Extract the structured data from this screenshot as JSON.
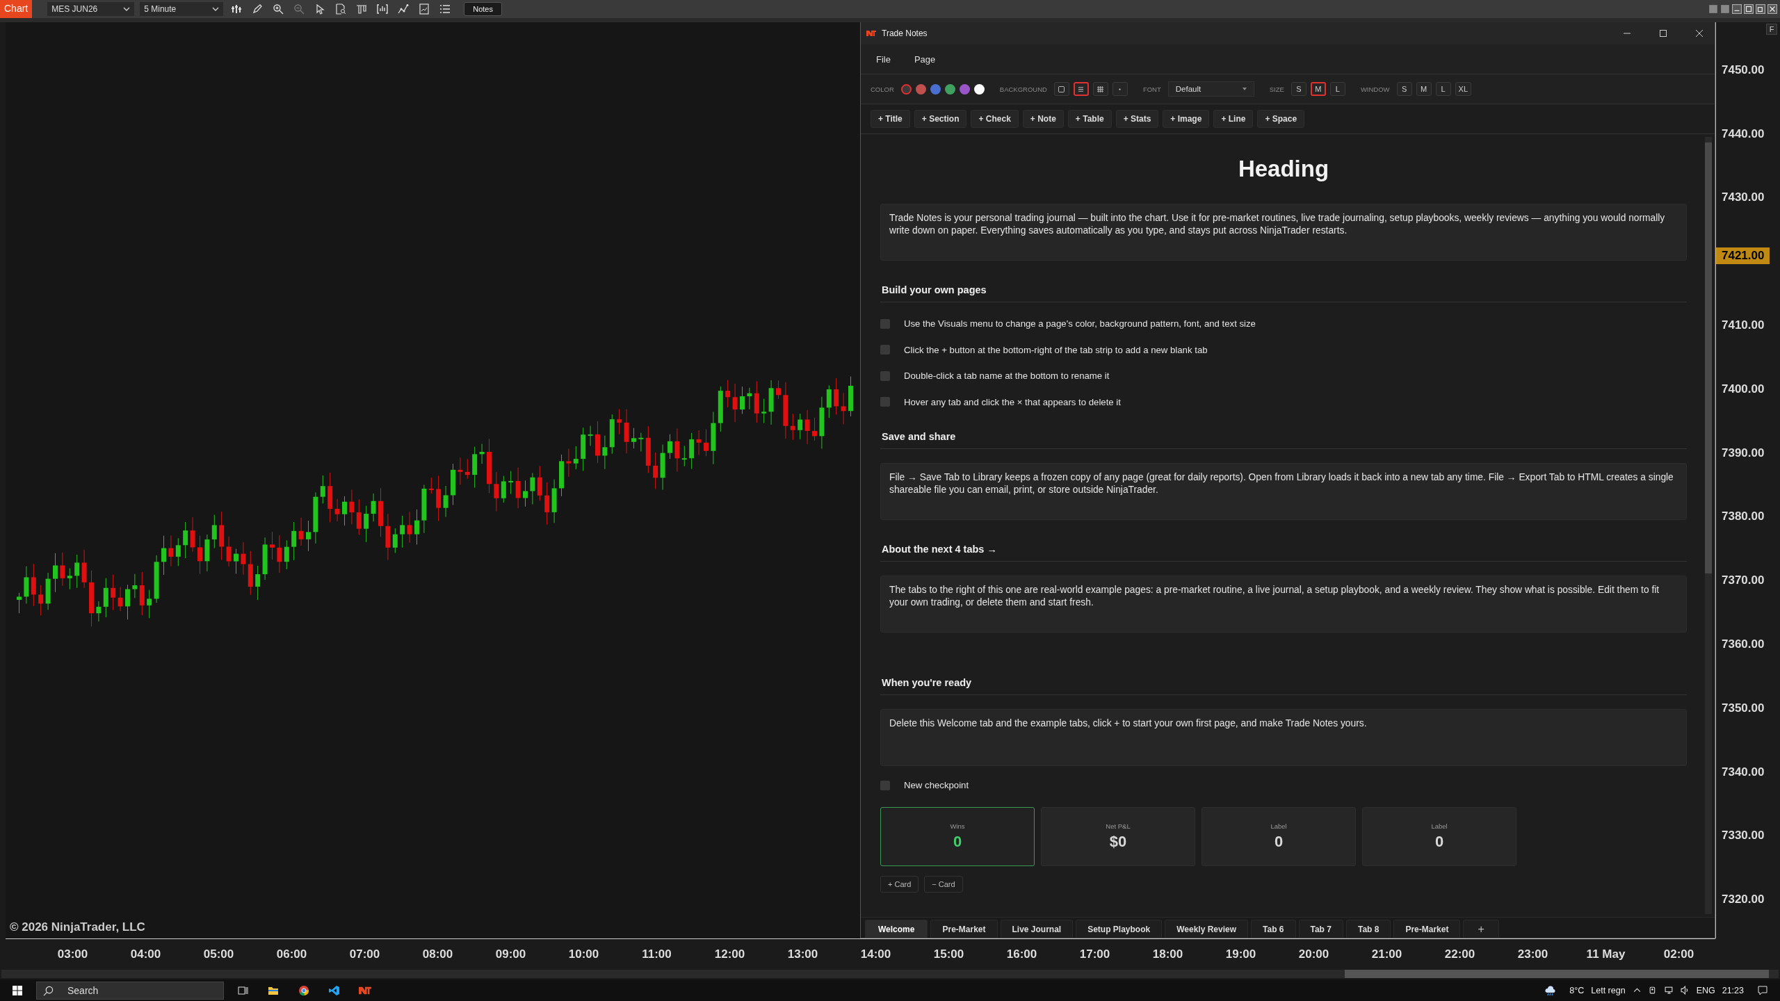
{
  "top_bar": {
    "app_label": "Chart",
    "instrument": "MES JUN26",
    "interval": "5 Minute",
    "notes_button": "Notes"
  },
  "chart": {
    "copyright": "© 2026 NinjaTrader, LLC",
    "price_labels": [
      {
        "kind": "tick",
        "text": "7450.00"
      },
      {
        "kind": "tick",
        "text": "7440.00"
      },
      {
        "kind": "tick",
        "text": "7430.00"
      },
      {
        "kind": "current",
        "text": "7421.00"
      },
      {
        "kind": "tick",
        "text": "7410.00"
      },
      {
        "kind": "tick",
        "text": "7400.00"
      },
      {
        "kind": "tick",
        "text": "7390.00"
      },
      {
        "kind": "tick",
        "text": "7380.00"
      },
      {
        "kind": "tick",
        "text": "7370.00"
      },
      {
        "kind": "tick",
        "text": "7360.00"
      },
      {
        "kind": "tick",
        "text": "7350.00"
      },
      {
        "kind": "tick",
        "text": "7340.00"
      },
      {
        "kind": "tick",
        "text": "7330.00"
      },
      {
        "kind": "tick",
        "text": "7320.00"
      }
    ],
    "axis_button": "F",
    "time_labels": [
      "03:00",
      "04:00",
      "05:00",
      "06:00",
      "07:00",
      "08:00",
      "09:00",
      "10:00",
      "11:00",
      "12:00",
      "13:00",
      "14:00",
      "15:00",
      "16:00",
      "17:00",
      "18:00",
      "19:00",
      "20:00",
      "21:00",
      "22:00",
      "23:00",
      "11 May",
      "02:00"
    ]
  },
  "notes_window": {
    "title": "Trade Notes",
    "menu": [
      "File",
      "Page"
    ],
    "toolbar": {
      "color_label": "COLOR",
      "colors": [
        {
          "color": "#3a3a3a",
          "selected": true
        },
        {
          "color": "#c0504d",
          "selected": false
        },
        {
          "color": "#4a6fd0",
          "selected": false
        },
        {
          "color": "#3fa060",
          "selected": false
        },
        {
          "color": "#9a55c8",
          "selected": false
        },
        {
          "color": "#ffffff",
          "selected": false
        }
      ],
      "background_label": "BACKGROUND",
      "backgrounds": [
        {
          "kind": "plain",
          "selected": false
        },
        {
          "kind": "lines",
          "selected": true
        },
        {
          "kind": "grid",
          "selected": false
        },
        {
          "kind": "dots",
          "selected": false
        }
      ],
      "font_label": "FONT",
      "font": "Default",
      "size_label": "SIZE",
      "sizes": [
        {
          "label": "S",
          "selected": false
        },
        {
          "label": "M",
          "selected": true
        },
        {
          "label": "L",
          "selected": false
        }
      ],
      "window_label": "WINDOW",
      "windows": [
        {
          "label": "S",
          "selected": false
        },
        {
          "label": "M",
          "selected": false
        },
        {
          "label": "L",
          "selected": false
        },
        {
          "label": "XL",
          "selected": false
        }
      ]
    },
    "insert_buttons": [
      "+ Title",
      "+ Section",
      "+ Check",
      "+ Note",
      "+ Table",
      "+ Stats",
      "+ Image",
      "+ Line",
      "+ Space"
    ],
    "blocks": [
      {
        "kind": "title",
        "text": "Heading"
      },
      {
        "kind": "note",
        "text": "Trade Notes is your personal trading journal — built into the chart. Use it for pre-market routines, live trade journaling, setup playbooks, weekly reviews — anything you would normally write down on paper. Everything saves automatically as you type, and stays put across NinjaTrader restarts."
      },
      {
        "kind": "section",
        "text": "Build your own pages"
      },
      {
        "kind": "check",
        "text": "Use the Visuals menu to change a page's color, background pattern, font, and text size",
        "checked": false
      },
      {
        "kind": "check",
        "text": "Click the + button at the bottom-right of the tab strip to add a new blank tab",
        "checked": false
      },
      {
        "kind": "check",
        "text": "Double-click a tab name at the bottom to rename it",
        "checked": false
      },
      {
        "kind": "check",
        "text": "Hover any tab and click the × that appears to delete it",
        "checked": false
      },
      {
        "kind": "section",
        "text": "Save and share"
      },
      {
        "kind": "note",
        "text": "File → Save Tab to Library keeps a frozen copy of any page (great for daily reports). Open from Library loads it back into a new tab any time. File → Export Tab to HTML creates a single shareable file you can email, print, or store outside NinjaTrader."
      },
      {
        "kind": "section",
        "text": "About the next 4 tabs →"
      },
      {
        "kind": "note",
        "text": "The tabs to the right of this one are real-world example pages: a pre-market routine, a live journal, a setup playbook, and a weekly review. They show what is possible. Edit them to fit your own trading, or delete them and start fresh."
      },
      {
        "kind": "space"
      },
      {
        "kind": "section",
        "text": "When you're ready"
      },
      {
        "kind": "note",
        "text": "Delete this Welcome tab and the example tabs, click + to start your own first page, and make Trade Notes yours."
      },
      {
        "kind": "check",
        "text": "New checkpoint",
        "checked": false
      },
      {
        "kind": "stats",
        "cards": [
          {
            "label": "Wins",
            "value": "0",
            "highlighted": true
          },
          {
            "label": "Net P&L",
            "value": "$0",
            "highlighted": false
          },
          {
            "label": "Label",
            "value": "0",
            "highlighted": false
          },
          {
            "label": "Label",
            "value": "0",
            "highlighted": false
          }
        ],
        "buttons": [
          "+ Card",
          "− Card"
        ]
      }
    ],
    "tabs": [
      {
        "label": "Welcome",
        "selected": true
      },
      {
        "label": "Pre-Market",
        "selected": false
      },
      {
        "label": "Live Journal",
        "selected": false
      },
      {
        "label": "Setup Playbook",
        "selected": false
      },
      {
        "label": "Weekly Review",
        "selected": false
      },
      {
        "label": "Tab 6",
        "selected": false
      },
      {
        "label": "Tab 7",
        "selected": false
      },
      {
        "label": "Tab 8",
        "selected": false
      },
      {
        "label": "Pre-Market",
        "selected": false
      }
    ],
    "add_tab": "+"
  },
  "taskbar": {
    "search_placeholder": "Search",
    "temperature": "8°C",
    "weather": "Lett regn",
    "language": "ENG",
    "time": "21:23"
  }
}
